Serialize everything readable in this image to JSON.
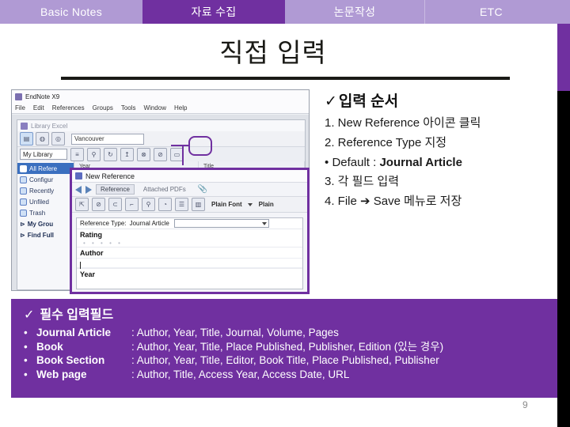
{
  "tabs": [
    {
      "label": "Basic Notes",
      "active": false
    },
    {
      "label": "자료 수집",
      "active": true
    },
    {
      "label": "논문작성",
      "active": false
    },
    {
      "label": "ETC",
      "active": false
    }
  ],
  "title": "직접 입력",
  "right_block": {
    "check": "✓",
    "heading": "입력 순서",
    "lines": [
      "1. New Reference 아이콘 클릭",
      "2. Reference Type 지정"
    ],
    "bullet_line": {
      "bullet": "•",
      "prefix": "Default : ",
      "bold": "Journal Article"
    },
    "lines2": [
      "3. 각 필드 입력",
      "4. File ➔ Save 메뉴로 저장"
    ]
  },
  "screenshot": {
    "app_title": "EndNote X9",
    "menus": [
      "File",
      "Edit",
      "References",
      "Groups",
      "Tools",
      "Window",
      "Help"
    ],
    "inner_window_title": "Library Excel",
    "style_box": "Vancouver",
    "library_tab": "My Library",
    "sidebar": [
      {
        "label": "All Refere",
        "selected": true
      },
      {
        "label": "Configur",
        "selected": false
      },
      {
        "label": "Recently",
        "selected": false
      },
      {
        "label": "Unfiled",
        "selected": false
      },
      {
        "label": "Trash",
        "selected": false
      },
      {
        "label": "My Grou",
        "group": true
      },
      {
        "label": "Find Full",
        "group": true
      }
    ],
    "grid_headers": [
      "Year",
      "Title"
    ]
  },
  "dialog": {
    "title": "New Reference",
    "tabs": [
      {
        "label": "Reference",
        "active": true
      },
      {
        "label": "Attached PDFs",
        "active": false
      }
    ],
    "font_label": "Plain Font",
    "font_size_label": "Plain",
    "reference_type_label": "Reference Type:",
    "reference_type_value": "Journal Article",
    "fields": [
      {
        "label": "Rating",
        "value": "• • • • •"
      },
      {
        "label": "Author",
        "value": ""
      },
      {
        "label": "Year",
        "value": ""
      }
    ]
  },
  "panel": {
    "check": "✓",
    "heading": "필수 입력필드",
    "rows": [
      {
        "bullet": "•",
        "key": "Journal Article",
        "value": ": Author, Year, Title, Journal, Volume, Pages"
      },
      {
        "bullet": "•",
        "key": "Book",
        "value": ": Author, Year, Title, Place Published, Publisher, Edition (있는 경우)"
      },
      {
        "bullet": "•",
        "key": "Book Section",
        "value": ": Author, Year, Title, Editor, Book Title, Place Published, Publisher"
      },
      {
        "bullet": "•",
        "key": "Web page",
        "value": ": Author, Title, Access Year, Access Date, URL"
      }
    ]
  },
  "page_number": "9",
  "colors": {
    "accent_purple": "#7030a0",
    "light_purple": "#b09ad4",
    "text_dark": "#1a1a16"
  }
}
